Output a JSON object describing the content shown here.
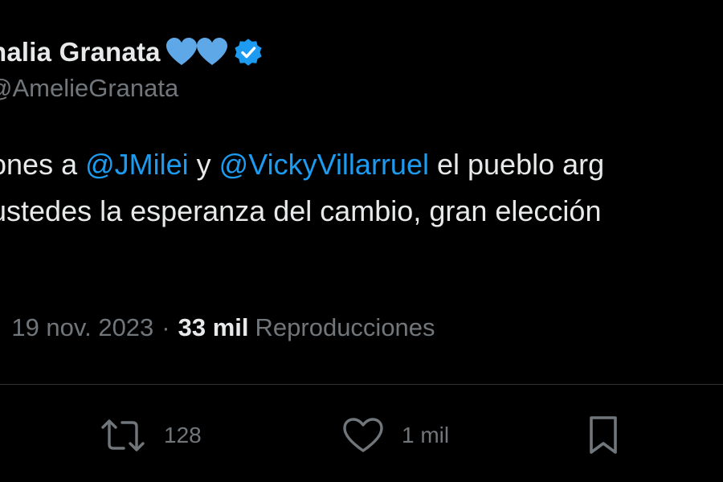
{
  "author": {
    "display_name": "nalia Granata",
    "handle": "AmelieGranata",
    "emoji_icons": [
      "blue-heart-icon",
      "blue-heart-icon"
    ],
    "verified_icon": "verified-badge-icon"
  },
  "tweet": {
    "line1": {
      "prefix": "ones a ",
      "mention1": "@JMilei",
      "middle": " y ",
      "mention2": "@VickyVillarruel",
      "suffix": " el pueblo arg"
    },
    "line2": "ustedes la esperanza del cambio, gran elección"
  },
  "meta": {
    "leading": "·",
    "date": "19 nov. 2023",
    "separator": "·",
    "views_count": "33 mil",
    "views_label": "Reproducciones"
  },
  "actions": {
    "retweets": {
      "icon": "retweet-icon",
      "count": "128"
    },
    "likes": {
      "icon": "heart-icon",
      "count": "1 mil"
    },
    "bookmark": {
      "icon": "bookmark-icon"
    }
  },
  "colors": {
    "background": "#000000",
    "text": "#e7e9ea",
    "secondary": "#71767b",
    "link": "#1d9bf0",
    "heart_emoji": "#5fa8e8",
    "verified": "#1d9bf0",
    "divider": "#2f3336"
  }
}
